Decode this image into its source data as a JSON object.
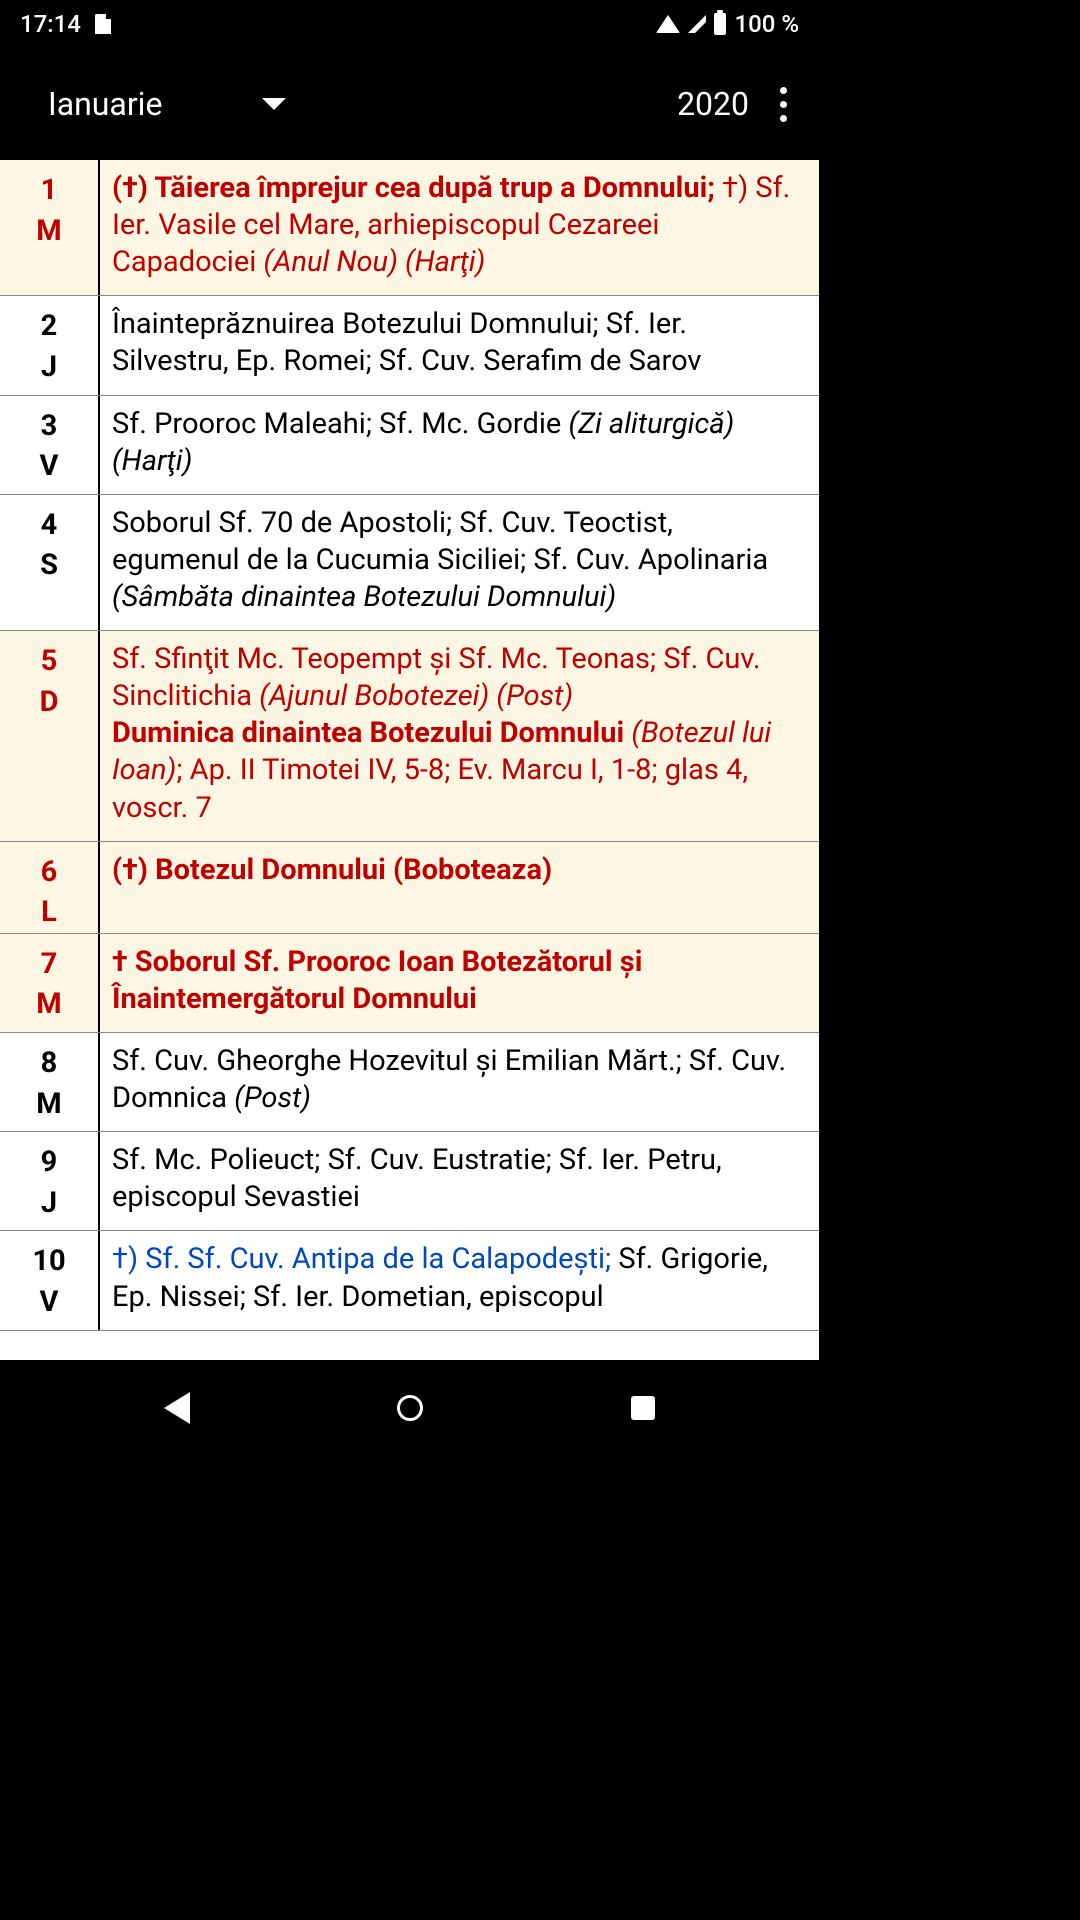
{
  "status": {
    "time": "17:14",
    "battery_text": "100 %"
  },
  "appbar": {
    "month": "Ianuarie",
    "year": "2020"
  },
  "days": [
    {
      "num": "1",
      "abbr": "M",
      "date_color": "red",
      "highlight": true,
      "segments": [
        {
          "text": "(†) Tăierea împrejur cea după trup a Domnului; ",
          "color": "red",
          "bold": true
        },
        {
          "text": "†) Sf. Ier. Vasile cel Mare, arhiepiscopul Cezareei Capadociei ",
          "color": "red"
        },
        {
          "text": "(Anul Nou) (Harţi)",
          "color": "red",
          "italic": true
        }
      ]
    },
    {
      "num": "2",
      "abbr": "J",
      "date_color": "black",
      "highlight": false,
      "segments": [
        {
          "text": "Înainteprăznuirea Botezului Domnului; Sf. Ier. Silvestru, Ep. Romei; Sf. Cuv. Serafim de Sarov",
          "color": "black"
        }
      ]
    },
    {
      "num": "3",
      "abbr": "V",
      "date_color": "black",
      "highlight": false,
      "segments": [
        {
          "text": "Sf. Prooroc Maleahi; Sf. Mc. Gordie ",
          "color": "black"
        },
        {
          "text": "(Zi aliturgică) (Harţi)",
          "color": "black",
          "italic": true
        }
      ]
    },
    {
      "num": "4",
      "abbr": "S",
      "date_color": "black",
      "highlight": false,
      "segments": [
        {
          "text": "Soborul Sf. 70 de Apostoli; Sf. Cuv. Teoctist, egumenul de la Cucumia Siciliei; Sf. Cuv. Apolinaria ",
          "color": "black"
        },
        {
          "text": "(Sâmbăta dinaintea Botezului Domnului)",
          "color": "black",
          "italic": true
        }
      ]
    },
    {
      "num": "5",
      "abbr": "D",
      "date_color": "red",
      "highlight": true,
      "segments": [
        {
          "text": "Sf. Sfinţit Mc. Teopempt și Sf. Mc. Teonas; Sf. Cuv. Sinclitichia ",
          "color": "red"
        },
        {
          "text": "(Ajunul Bobotezei) (Post)",
          "color": "red",
          "italic": true
        },
        {
          "text": "Duminica dinaintea Botezului Domnului ",
          "color": "red",
          "bold": true,
          "block": true
        },
        {
          "text": "(Botezul lui Ioan)",
          "color": "red",
          "italic": true
        },
        {
          "text": "; Ap. II Timotei IV, 5-8; Ev. Marcu I, 1-8; glas 4, voscr. 7",
          "color": "red"
        }
      ]
    },
    {
      "num": "6",
      "abbr": "L",
      "date_color": "red",
      "highlight": true,
      "segments": [
        {
          "text": "(†) Botezul Domnului (Boboteaza)",
          "color": "red",
          "bold": true
        }
      ]
    },
    {
      "num": "7",
      "abbr": "M",
      "date_color": "red",
      "highlight": true,
      "segments": [
        {
          "text": "† Soborul Sf. Prooroc Ioan Botezătorul și Înaintemergătorul Domnului",
          "color": "red",
          "bold": true
        }
      ]
    },
    {
      "num": "8",
      "abbr": "M",
      "date_color": "black",
      "highlight": false,
      "segments": [
        {
          "text": "Sf. Cuv. Gheorghe Hozevitul și Emilian Mărt.; Sf. Cuv. Domnica ",
          "color": "black"
        },
        {
          "text": "(Post)",
          "color": "black",
          "italic": true
        }
      ]
    },
    {
      "num": "9",
      "abbr": "J",
      "date_color": "black",
      "highlight": false,
      "segments": [
        {
          "text": "Sf. Mc. Polieuct; Sf. Cuv. Eustratie; Sf. Ier. Petru, episcopul Sevastiei",
          "color": "black"
        }
      ]
    },
    {
      "num": "10",
      "abbr": "V",
      "date_color": "black",
      "highlight": false,
      "segments": [
        {
          "text": "†) Sf. Sf. Cuv. Antipa de la Calapodești; ",
          "color": "blue"
        },
        {
          "text": "Sf. Grigorie, Ep. Nissei; Sf. Ier. Dometian, episcopul",
          "color": "black"
        }
      ]
    }
  ]
}
